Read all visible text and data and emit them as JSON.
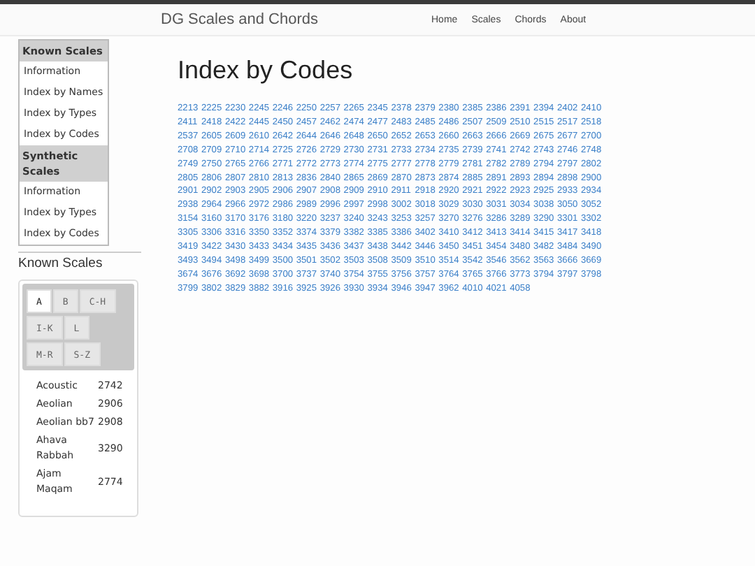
{
  "navbar": {
    "brand": "DG Scales and Chords",
    "links": [
      "Home",
      "Scales",
      "Chords",
      "About"
    ]
  },
  "sidebar": {
    "sections": [
      {
        "title": "Known Scales",
        "items": [
          "Information",
          "Index by Names",
          "Index by Types",
          "Index by Codes"
        ]
      },
      {
        "title": "Synthetic Scales",
        "items": [
          "Information",
          "Index by Types",
          "Index by Codes"
        ]
      }
    ]
  },
  "scale_browser": {
    "heading": "Known Scales",
    "tab_rows": [
      [
        {
          "label": "A",
          "selected": true
        },
        {
          "label": "B",
          "selected": false
        },
        {
          "label": "C-H",
          "selected": false
        }
      ],
      [
        {
          "label": "I-K",
          "selected": false
        },
        {
          "label": "L",
          "selected": false
        }
      ],
      [
        {
          "label": "M-R",
          "selected": false
        },
        {
          "label": "S-Z",
          "selected": false
        }
      ]
    ],
    "scales": [
      {
        "name": "Acoustic",
        "code": "2742"
      },
      {
        "name": "Aeolian",
        "code": "2906"
      },
      {
        "name": "Aeolian bb7",
        "code": "2908"
      },
      {
        "name": "Ahava Rabbah",
        "code": "3290"
      },
      {
        "name": "Ajam Maqam",
        "code": "2774"
      }
    ]
  },
  "main": {
    "title": "Index by Codes",
    "codes": [
      "2213",
      "2225",
      "2230",
      "2245",
      "2246",
      "2250",
      "2257",
      "2265",
      "2345",
      "2378",
      "2379",
      "2380",
      "2385",
      "2386",
      "2391",
      "2394",
      "2402",
      "2410",
      "2411",
      "2418",
      "2422",
      "2445",
      "2450",
      "2457",
      "2462",
      "2474",
      "2477",
      "2483",
      "2485",
      "2486",
      "2507",
      "2509",
      "2510",
      "2515",
      "2517",
      "2518",
      "2537",
      "2605",
      "2609",
      "2610",
      "2642",
      "2644",
      "2646",
      "2648",
      "2650",
      "2652",
      "2653",
      "2660",
      "2663",
      "2666",
      "2669",
      "2675",
      "2677",
      "2700",
      "2708",
      "2709",
      "2710",
      "2714",
      "2725",
      "2726",
      "2729",
      "2730",
      "2731",
      "2733",
      "2734",
      "2735",
      "2739",
      "2741",
      "2742",
      "2743",
      "2746",
      "2748",
      "2749",
      "2750",
      "2765",
      "2766",
      "2771",
      "2772",
      "2773",
      "2774",
      "2775",
      "2777",
      "2778",
      "2779",
      "2781",
      "2782",
      "2789",
      "2794",
      "2797",
      "2802",
      "2805",
      "2806",
      "2807",
      "2810",
      "2813",
      "2836",
      "2840",
      "2865",
      "2869",
      "2870",
      "2873",
      "2874",
      "2885",
      "2891",
      "2893",
      "2894",
      "2898",
      "2900",
      "2901",
      "2902",
      "2903",
      "2905",
      "2906",
      "2907",
      "2908",
      "2909",
      "2910",
      "2911",
      "2918",
      "2920",
      "2921",
      "2922",
      "2923",
      "2925",
      "2933",
      "2934",
      "2938",
      "2964",
      "2966",
      "2972",
      "2986",
      "2989",
      "2996",
      "2997",
      "2998",
      "3002",
      "3018",
      "3029",
      "3030",
      "3031",
      "3034",
      "3038",
      "3050",
      "3052",
      "3154",
      "3160",
      "3170",
      "3176",
      "3180",
      "3220",
      "3237",
      "3240",
      "3243",
      "3253",
      "3257",
      "3270",
      "3276",
      "3286",
      "3289",
      "3290",
      "3301",
      "3302",
      "3305",
      "3306",
      "3316",
      "3350",
      "3352",
      "3374",
      "3379",
      "3382",
      "3385",
      "3386",
      "3402",
      "3410",
      "3412",
      "3413",
      "3414",
      "3415",
      "3417",
      "3418",
      "3419",
      "3422",
      "3430",
      "3433",
      "3434",
      "3435",
      "3436",
      "3437",
      "3438",
      "3442",
      "3446",
      "3450",
      "3451",
      "3454",
      "3480",
      "3482",
      "3484",
      "3490",
      "3493",
      "3494",
      "3498",
      "3499",
      "3500",
      "3501",
      "3502",
      "3503",
      "3508",
      "3509",
      "3510",
      "3514",
      "3542",
      "3546",
      "3562",
      "3563",
      "3666",
      "3669",
      "3674",
      "3676",
      "3692",
      "3698",
      "3700",
      "3737",
      "3740",
      "3754",
      "3755",
      "3756",
      "3757",
      "3764",
      "3765",
      "3766",
      "3773",
      "3794",
      "3797",
      "3798",
      "3799",
      "3802",
      "3829",
      "3882",
      "3916",
      "3925",
      "3926",
      "3930",
      "3934",
      "3946",
      "3947",
      "3962",
      "4010",
      "4021",
      "4058"
    ]
  }
}
